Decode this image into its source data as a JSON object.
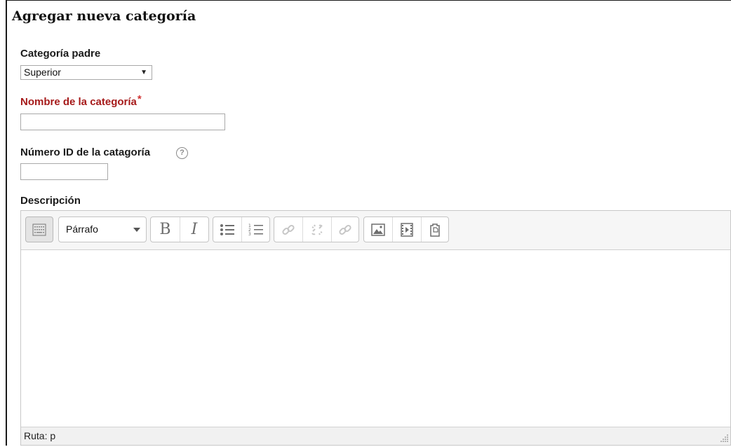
{
  "form": {
    "title": "Agregar nueva categoría",
    "parent_label": "Categoría padre",
    "parent_value": "Superior",
    "name_label": "Nombre de la categoría",
    "name_required_mark": "*",
    "name_value": "",
    "idnumber_label": "Número ID de la catagoría",
    "idnumber_value": "",
    "description_label": "Descripción"
  },
  "editor": {
    "format_value": "Párrafo",
    "bold_label": "B",
    "italic_label": "I",
    "path_text": "Ruta: p",
    "tools": {
      "toggle": "keyboard-toggle-icon",
      "bullets": "bullet-list-icon",
      "numbers": "numbered-list-icon",
      "link": "link-icon",
      "unlink": "unlink-icon",
      "anchor": "anchor-link-icon",
      "image": "image-icon",
      "media": "media-icon",
      "files": "manage-files-icon"
    }
  },
  "colors": {
    "required_label": "#a61b1b",
    "required_star": "#d13434",
    "icon": "#6d6d6d",
    "icon_disabled": "#c6c6c6"
  }
}
